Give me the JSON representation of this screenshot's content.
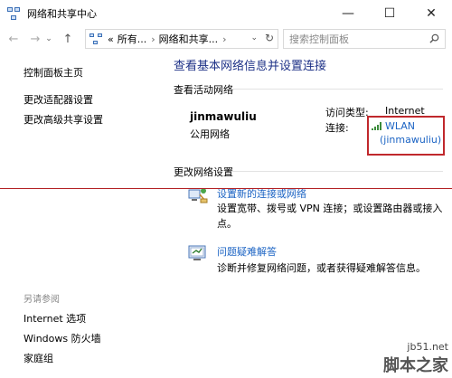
{
  "window": {
    "title": "网络和共享中心",
    "minimize": "—",
    "maximize": "☐",
    "close": "✕"
  },
  "nav": {
    "back": "←",
    "forward": "→",
    "recent": "⌄",
    "up": "↑"
  },
  "address": {
    "crumb_prefix": "«",
    "crumbs": [
      "所有...",
      "网络和共享...",
      "›",
      "›"
    ],
    "dropdown": "⌄",
    "refresh": "↻"
  },
  "search": {
    "placeholder": "搜索控制面板"
  },
  "sidebar": {
    "links": [
      "控制面板主页",
      "更改适配器设置",
      "更改高级共享设置"
    ],
    "see_also_title": "另请参阅",
    "see_also": [
      "Internet 选项",
      "Windows 防火墙",
      "家庭组"
    ]
  },
  "main": {
    "heading": "查看基本网络信息并设置连接",
    "active_section": "查看活动网络",
    "network": {
      "name": "jinmawuliu",
      "category": "公用网络",
      "access_label": "访问类型:",
      "access_value": "Internet",
      "conn_label": "连接:",
      "conn_value": "WLAN",
      "conn_sub": "(jinmawuliu)"
    },
    "change_section": "更改网络设置",
    "tasks": [
      {
        "link": "设置新的连接或网络",
        "desc": "设置宽带、拨号或 VPN 连接；或设置路由器或接入点。"
      },
      {
        "link": "问题疑难解答",
        "desc": "诊断并修复网络问题，或者获得疑难解答信息。"
      }
    ]
  },
  "watermark": {
    "url": "jb51.net",
    "name": "脚本之家"
  },
  "colors": {
    "heading": "#1e3287",
    "link": "#1c64c4",
    "highlight": "#c0282c"
  }
}
